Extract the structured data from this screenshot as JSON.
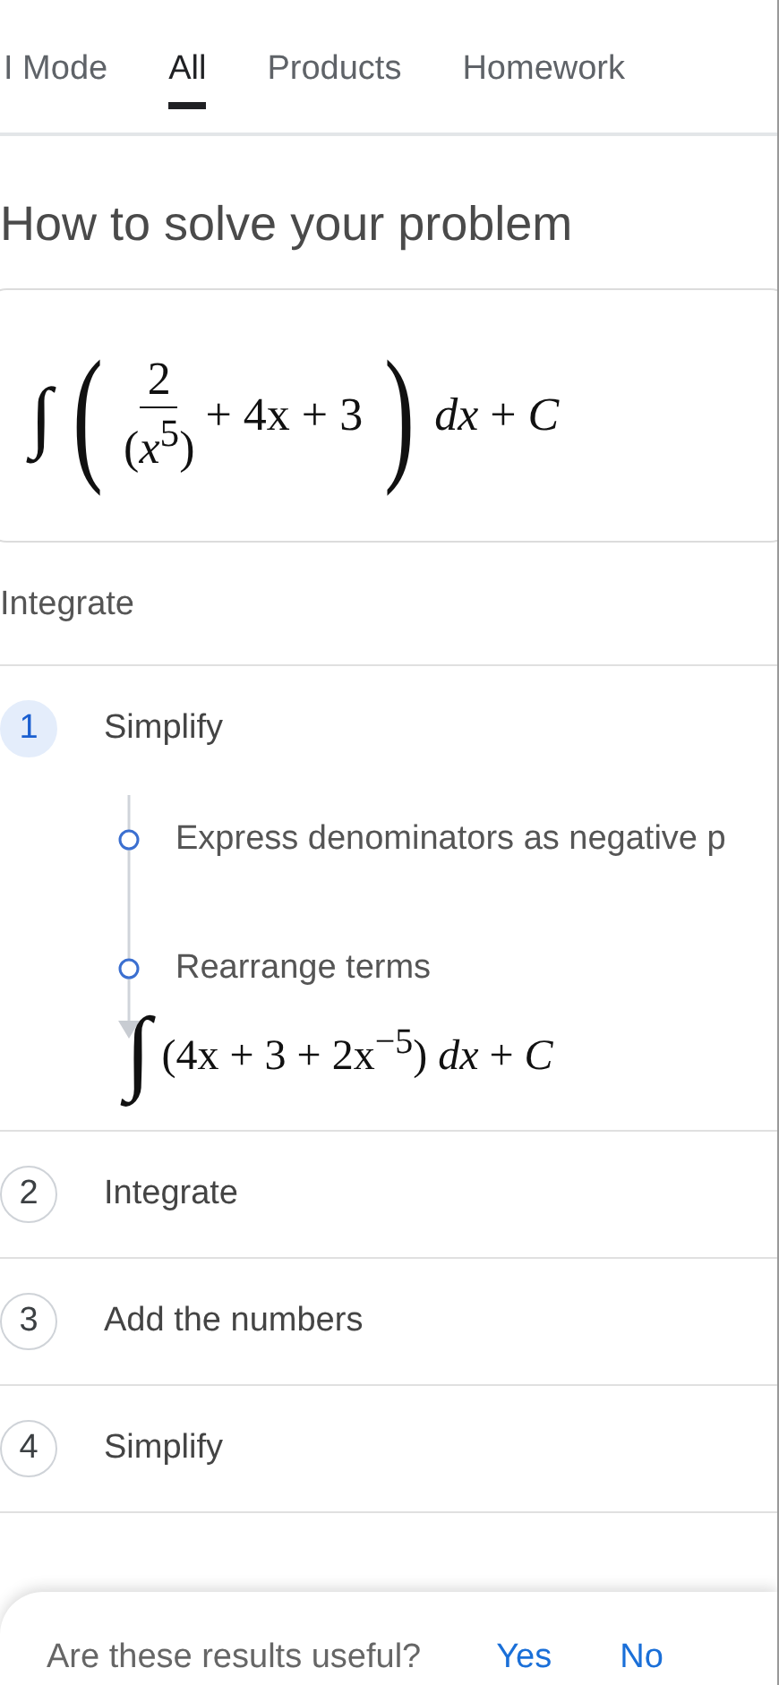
{
  "tabs": [
    {
      "label": "I Mode",
      "selected": false
    },
    {
      "label": "All",
      "selected": true
    },
    {
      "label": "Products",
      "selected": false
    },
    {
      "label": "Homework",
      "selected": false
    }
  ],
  "heading": "How to solve your problem",
  "problem": {
    "integral": "∫",
    "open": "(",
    "numerator": "2",
    "denominator": "(*x*$^{5}$)",
    "terms": "+ 4x + 3",
    "close": ")",
    "tail": "*dx* + *C*"
  },
  "method": "Integrate",
  "steps": [
    {
      "number": "1",
      "label": "Simplify",
      "selected": true,
      "substeps": [
        "Express denominators as negative p",
        "Rearrange terms"
      ],
      "result_integral": "∫",
      "result": "(4x + 3 + 2x$^{−5}$) *dx* + *C*"
    },
    {
      "number": "2",
      "label": "Integrate",
      "selected": false
    },
    {
      "number": "3",
      "label": "Add the numbers",
      "selected": false
    },
    {
      "number": "4",
      "label": "Simplify",
      "selected": false
    }
  ],
  "feedback": {
    "question": "Are these results useful?",
    "yes": "Yes",
    "no": "No"
  }
}
